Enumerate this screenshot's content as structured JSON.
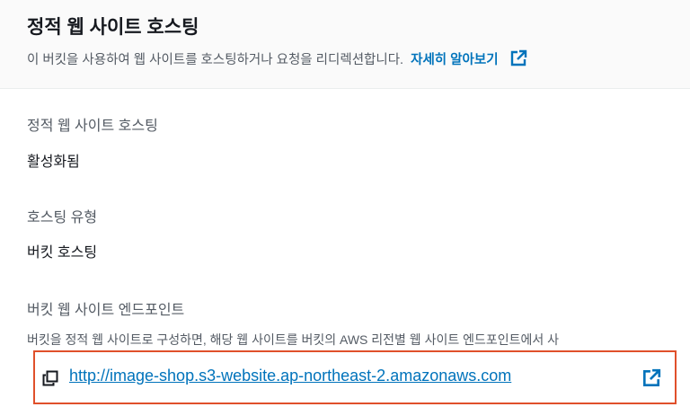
{
  "header": {
    "title": "정적 웹 사이트 호스팅",
    "description": "이 버킷을 사용하여 웹 사이트를 호스팅하거나 요청을 리디렉션합니다.",
    "learn_more": "자세히 알아보기",
    "learn_more_icon": "external-link-icon"
  },
  "fields": {
    "hosting": {
      "label": "정적 웹 사이트 호스팅",
      "value": "활성화됨"
    },
    "hosting_type": {
      "label": "호스팅 유형",
      "value": "버킷 호스팅"
    },
    "endpoint": {
      "label": "버킷 웹 사이트 엔드포인트",
      "description": "버킷을 정적 웹 사이트로 구성하면, 해당 웹 사이트를 버킷의 AWS 리전별 웹 사이트 엔드포인트에서 사",
      "url": "http://image-shop.s3-website.ap-northeast-2.amazonaws.com",
      "copy_icon": "copy-icon",
      "link_icon": "external-link-icon"
    }
  },
  "colors": {
    "link": "#0073bb",
    "highlight_border": "#e0502b",
    "muted_text": "#545b64",
    "text": "#16191f"
  }
}
